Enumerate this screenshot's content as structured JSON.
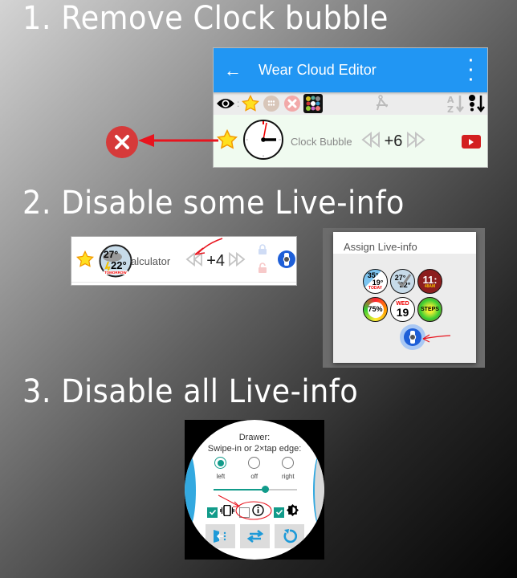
{
  "headings": {
    "step1": "1. Remove Clock bubble",
    "step2": "2. Disable some Live-info",
    "step3": "3. Disable all Live-info"
  },
  "editor": {
    "title": "Wear Cloud Editor",
    "toolbar_icons": [
      "eye-icon",
      "star-icon",
      "apps-icon",
      "delete-icon",
      "watchface-grid-icon",
      "compass-icon",
      "sort-az-icon",
      "sort-size-icon"
    ],
    "row": {
      "label": "Clock Bubble",
      "count": "+6"
    }
  },
  "calculator_row": {
    "label": "Calculator",
    "count": "+4",
    "bubble": {
      "high": "27°",
      "low": "22°",
      "caption": "TOMORROW"
    }
  },
  "assign_dialog": {
    "title": "Assign Live-info",
    "items": [
      {
        "name": "weather-today",
        "line1": "35°",
        "line2": "19°",
        "line3": "TODAY"
      },
      {
        "name": "weather-tomorrow",
        "line1": "27°",
        "line2": "22°",
        "line3": ""
      },
      {
        "name": "time",
        "line1": "11:",
        "line2": "48AM",
        "line3": ""
      },
      {
        "name": "battery",
        "line1": "75%",
        "line2": "",
        "line3": ""
      },
      {
        "name": "date",
        "line1": "WED",
        "line2": "19",
        "line3": ""
      },
      {
        "name": "steps",
        "line1": "STEPS",
        "line2": "",
        "line3": ""
      }
    ]
  },
  "watch_settings": {
    "drawer_title": "Drawer:",
    "drawer_subtitle": "Swipe-in or 2×tap edge:",
    "radio_options": [
      {
        "label": "left",
        "selected": true
      },
      {
        "label": "off",
        "selected": false
      },
      {
        "label": "right",
        "selected": false
      }
    ],
    "slider_value": 0.62,
    "checkboxes": [
      {
        "name": "vibrate",
        "checked": true
      },
      {
        "name": "live-info",
        "checked": false
      },
      {
        "name": "brightness",
        "checked": true
      }
    ]
  },
  "colors": {
    "appbar": "#2196f3",
    "accent_teal": "#119b8a",
    "remove_red": "#d63a3a",
    "annotation_red": "#e8141e",
    "watch_blue": "#33a9e0"
  }
}
